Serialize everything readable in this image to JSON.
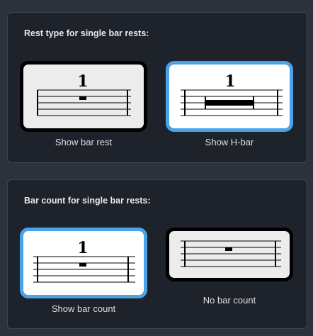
{
  "rest_type_section": {
    "title": "Rest type for single bar rests:",
    "options": [
      {
        "label": "Show bar rest",
        "count_numeral": "1",
        "selected": false
      },
      {
        "label": "Show H-bar",
        "count_numeral": "1",
        "selected": true
      }
    ]
  },
  "bar_count_section": {
    "title": "Bar count for single bar rests:",
    "options": [
      {
        "label": "Show bar count",
        "count_numeral": "1",
        "selected": true
      },
      {
        "label": "No bar count",
        "selected": false
      }
    ]
  },
  "colors": {
    "selected_border": "#4aa3e6",
    "unselected_border": "#000000",
    "panel_background": "#1e222a",
    "window_background": "#2d323a"
  }
}
